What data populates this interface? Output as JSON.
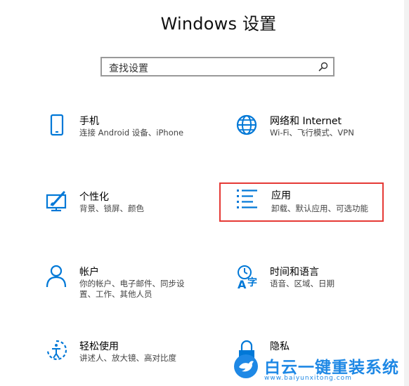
{
  "header": {
    "title": "Windows 设置"
  },
  "search": {
    "placeholder": "查找设置",
    "icon": "search-icon"
  },
  "tiles": [
    {
      "name": "手机",
      "desc": "连接 Android 设备、iPhone",
      "icon": "phone-icon"
    },
    {
      "name": "网络和 Internet",
      "desc": "Wi-Fi、飞行模式、VPN",
      "icon": "globe-icon"
    },
    {
      "name": "个性化",
      "desc": "背景、锁屏、颜色",
      "icon": "personalization-icon"
    },
    {
      "name": "应用",
      "desc": "卸载、默认应用、可选功能",
      "icon": "apps-list-icon"
    },
    {
      "name": "帐户",
      "desc_line1": "你的帐户、电子邮件、同步设",
      "desc_line2": "置、工作、其他人员",
      "icon": "account-icon"
    },
    {
      "name": "时间和语言",
      "desc": "语音、区域、日期",
      "icon": "time-language-icon"
    },
    {
      "name": "轻松使用",
      "desc": "讲述人、放大镜、高对比度",
      "icon": "ease-of-access-icon"
    },
    {
      "name": "隐私",
      "desc": "",
      "icon": "lock-icon"
    }
  ],
  "colors": {
    "accent": "#0078d7",
    "highlight_border": "#e53935",
    "watermark": "#1e88e5"
  },
  "watermark": {
    "text": "白云一键重装系统",
    "url": "www.baiyunxitong.com"
  }
}
